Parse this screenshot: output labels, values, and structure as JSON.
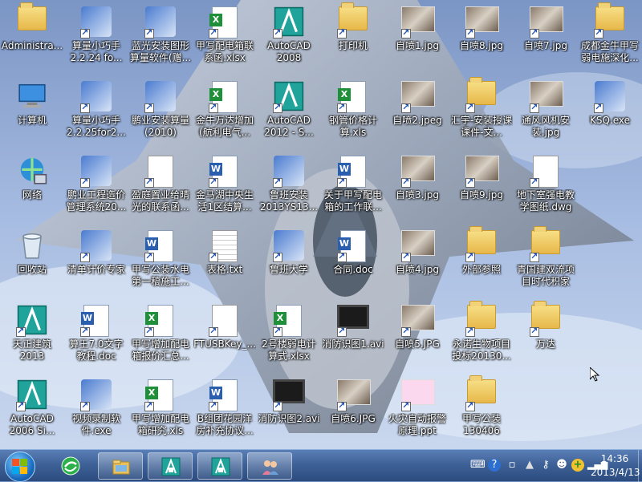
{
  "desktop": {
    "icons": [
      {
        "label": "Administra...",
        "kind": "user-folder"
      },
      {
        "label": "算量小巧手 2.2.24 fo...",
        "kind": "app"
      },
      {
        "label": "蓝光安装图形算量软件(赠...",
        "kind": "app"
      },
      {
        "label": "甲写配电箱联系函.xlsx",
        "kind": "xls"
      },
      {
        "label": "AutoCAD 2008",
        "kind": "autocad"
      },
      {
        "label": "打印机",
        "kind": "folder"
      },
      {
        "label": "自喷1.jpg",
        "kind": "jpg"
      },
      {
        "label": "自喷8.jpg",
        "kind": "jpg"
      },
      {
        "label": "自喷7.jpg",
        "kind": "jpg"
      },
      {
        "label": "成都金牛甲写弱电施深化...",
        "kind": "folder"
      },
      {
        "label": "计算机",
        "kind": "computer"
      },
      {
        "label": "算量小巧手 2.2.25for2...",
        "kind": "app"
      },
      {
        "label": "鹏业安装算量(2010)",
        "kind": "app"
      },
      {
        "label": "金牛万达增加(航利电气...",
        "kind": "xls"
      },
      {
        "label": "AutoCAD 2012 - S...",
        "kind": "autocad"
      },
      {
        "label": "钢管价格计算.xls",
        "kind": "xls"
      },
      {
        "label": "自喷2.jpeg",
        "kind": "jpg"
      },
      {
        "label": "汇宇-安装授课课件-文...",
        "kind": "folder"
      },
      {
        "label": "通风风机安装.jpg",
        "kind": "jpg"
      },
      {
        "label": "KSQ.exe",
        "kind": "app"
      },
      {
        "label": "网络",
        "kind": "network"
      },
      {
        "label": "鹏业工程造价管理系统20...",
        "kind": "app"
      },
      {
        "label": "盈庭置业给晴光的联系函...",
        "kind": "blank"
      },
      {
        "label": "金马湖中央生活1区结算...",
        "kind": "doc"
      },
      {
        "label": "鲁班安装 2013YS13...",
        "kind": "app"
      },
      {
        "label": "关于甲写配电箱的工作联...",
        "kind": "doc"
      },
      {
        "label": "自喷3.jpg",
        "kind": "jpg"
      },
      {
        "label": "自喷9.jpg",
        "kind": "jpg"
      },
      {
        "label": "地下室强电教学图纸.dwg",
        "kind": "blank"
      },
      {
        "label": "回收站",
        "kind": "recycle"
      },
      {
        "label": "清单计价专家",
        "kind": "app"
      },
      {
        "label": "甲写公装水电第一稿施工...",
        "kind": "doc"
      },
      {
        "label": "表格.txt",
        "kind": "txt"
      },
      {
        "label": "鲁班大学",
        "kind": "app"
      },
      {
        "label": "合同.doc",
        "kind": "doc"
      },
      {
        "label": "自喷4.jpg",
        "kind": "jpg"
      },
      {
        "label": "外部参照",
        "kind": "folder"
      },
      {
        "label": "青国建双流项目时代积家",
        "kind": "folder"
      },
      {
        "label": "天正建筑2013",
        "kind": "autocad"
      },
      {
        "label": "算王7.0文字教程.doc",
        "kind": "doc"
      },
      {
        "label": "甲写增加配电箱报价汇总...",
        "kind": "xls"
      },
      {
        "label": "FTUSBKey_...",
        "kind": "blank"
      },
      {
        "label": "2号楼弱电计算式.xlsx",
        "kind": "xls"
      },
      {
        "label": "消防识图1.avi",
        "kind": "video"
      },
      {
        "label": "自喷5.JPG",
        "kind": "jpg"
      },
      {
        "label": "永诺生物项目投标20130...",
        "kind": "folder"
      },
      {
        "label": "万达",
        "kind": "folder"
      },
      {
        "label": "AutoCAD 2006 Si...",
        "kind": "autocad"
      },
      {
        "label": "视频录制软件.exe",
        "kind": "app"
      },
      {
        "label": "甲写增加配电箱研究.xls",
        "kind": "xls"
      },
      {
        "label": "B组团花园洋房补充协议...",
        "kind": "doc"
      },
      {
        "label": "消防识图2.avi",
        "kind": "video"
      },
      {
        "label": "自喷6.JPG",
        "kind": "jpg"
      },
      {
        "label": "火灾自动报警原理.ppt",
        "kind": "ppt"
      },
      {
        "label": "甲写公装130406",
        "kind": "folder"
      }
    ]
  },
  "taskbar": {
    "buttons": [
      {
        "name": "360-browser",
        "icon": "globe-icon"
      },
      {
        "name": "explorer",
        "icon": "folder-icon"
      },
      {
        "name": "autocad-1",
        "icon": "autocad-icon"
      },
      {
        "name": "autocad-2",
        "icon": "autocad-icon"
      },
      {
        "name": "people",
        "icon": "users-icon"
      }
    ],
    "clock_time": "14:36",
    "clock_date": "2013/4/13"
  },
  "colors": {
    "taskbar": "#3c5f95",
    "autocad": "#1fa39a"
  }
}
